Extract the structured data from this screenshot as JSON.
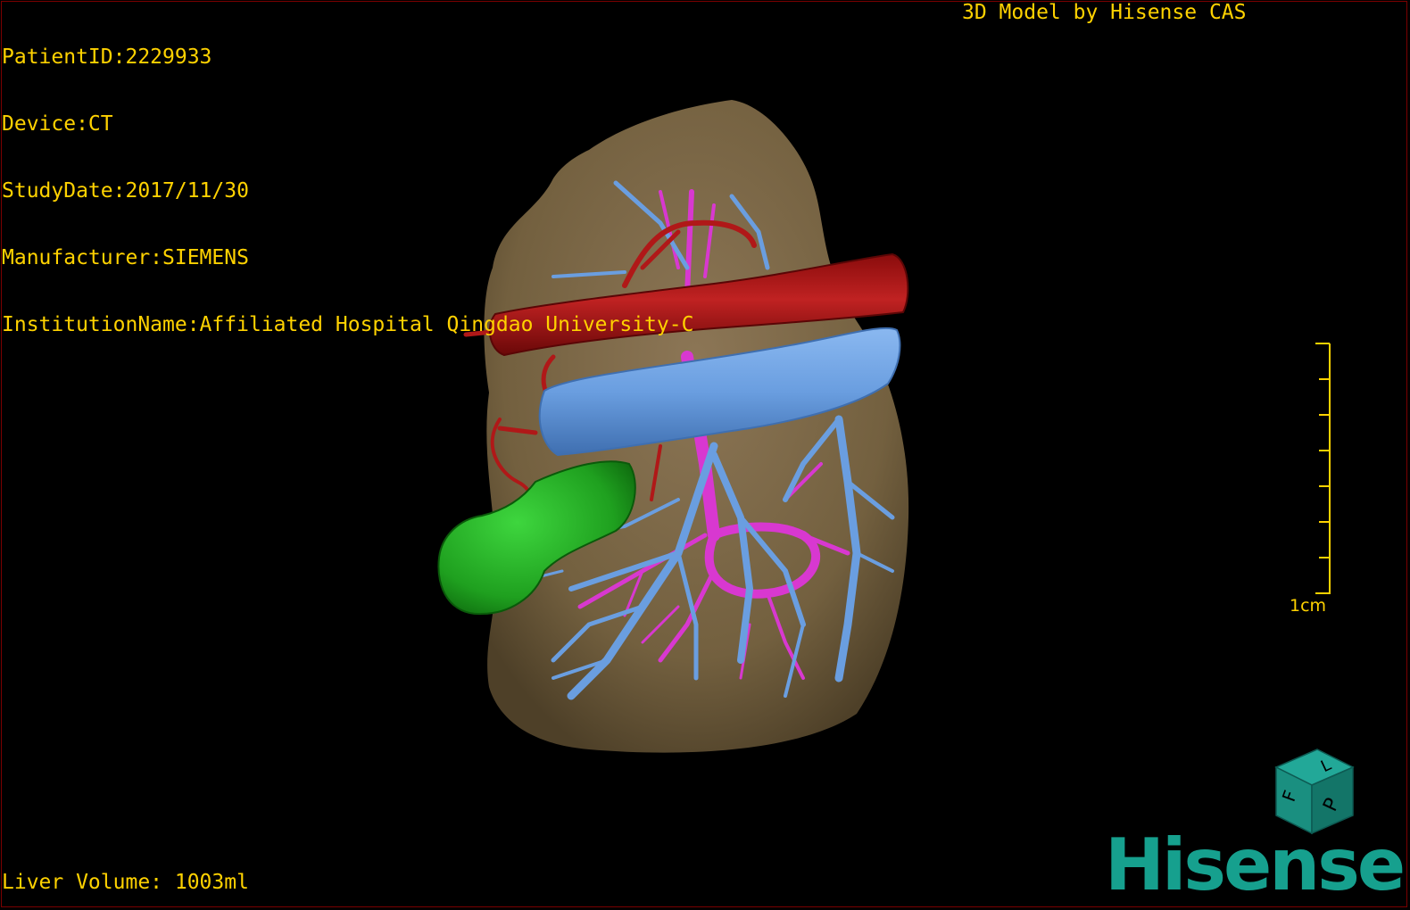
{
  "overlay": {
    "patient_id": "PatientID:2229933",
    "device": "Device:CT",
    "study_date": "StudyDate:2017/11/30",
    "manufacturer": "Manufacturer:SIEMENS",
    "institution": "InstitutionName:Affiliated Hospital Qingdao University-C"
  },
  "brand_text": "3D Model by Hisense CAS",
  "liver_volume": "Liver Volume: 1003ml",
  "scale_bar": {
    "label": "1cm"
  },
  "orientation_cube": {
    "faces": [
      "F",
      "L",
      "P"
    ],
    "color": "#1a8f80"
  },
  "logo": {
    "text": "Hisense",
    "color": "#16a08e"
  },
  "colors": {
    "liver": "#7a6648",
    "artery": "#a01010",
    "vein": "#6a9ee0",
    "portal": "#d838d0",
    "lesion": "#22b022",
    "overlay_text": "#ffd200"
  }
}
